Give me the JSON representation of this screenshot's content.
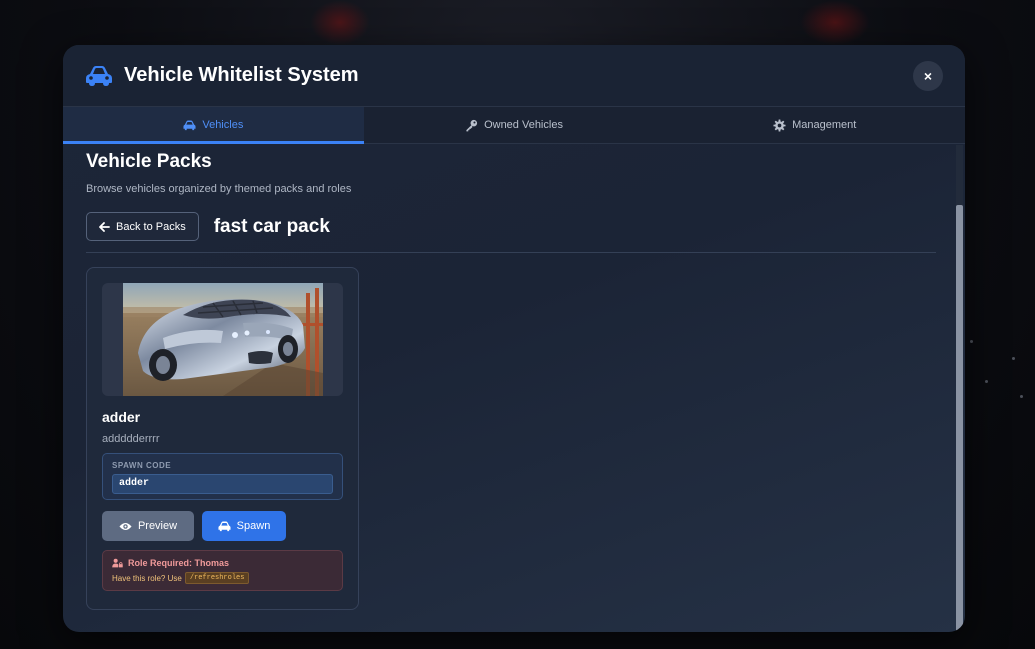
{
  "window": {
    "title": "Vehicle Whitelist System",
    "close_label": "×",
    "icon": "car-icon"
  },
  "tabs": [
    {
      "label": "Vehicles",
      "icon": "car-icon",
      "active": true
    },
    {
      "label": "Owned Vehicles",
      "icon": "key-icon",
      "active": false
    },
    {
      "label": "Management",
      "icon": "gear-icon",
      "active": false
    }
  ],
  "section": {
    "title": "Vehicle Packs",
    "subtitle": "Browse vehicles organized by themed packs and roles"
  },
  "pack": {
    "back_label": "Back to Packs",
    "name": "fast car pack"
  },
  "vehicle": {
    "name": "adder",
    "description": "addddderrrr",
    "spawn_code_label": "SPAWN CODE",
    "spawn_code": "adder",
    "preview_label": "Preview",
    "spawn_label": "Spawn",
    "role_required": "Role Required: Thomas",
    "role_hint": "Have this role? Use",
    "role_command": "/refreshroles"
  },
  "colors": {
    "accent": "#3b82f6",
    "spawn_button": "#2f73e8",
    "preview_button": "#5e6b82",
    "role_warning": "#f09a9a"
  }
}
